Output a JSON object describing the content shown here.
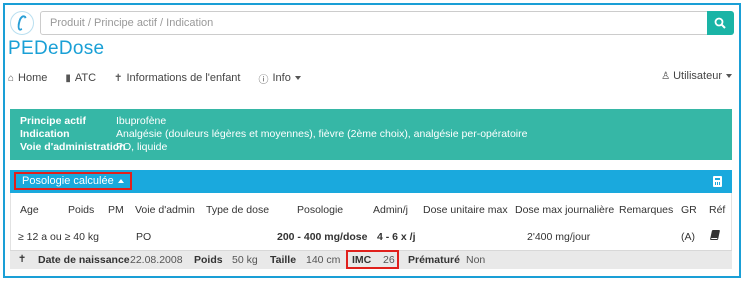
{
  "search": {
    "placeholder": "Produit / Principe actif / Indication"
  },
  "brand": "PEDeDose",
  "nav": {
    "items": [
      {
        "icon": "home-icon",
        "label": "Home"
      },
      {
        "icon": "book-icon",
        "label": "ATC"
      },
      {
        "icon": "child-icon",
        "label": "Informations de l'enfant"
      },
      {
        "icon": "info-icon",
        "label": "Info"
      }
    ],
    "user_label": "Utilisateur"
  },
  "info": {
    "principe_label": "Principe actif",
    "principe_value": "Ibuprofène",
    "indication_label": "Indication",
    "indication_value": "Analgésie (douleurs légères et moyennes), fièvre (2ème choix), analgésie per-opératoire",
    "voie_label": "Voie d'administration",
    "voie_value": "PO, liquide"
  },
  "posology": {
    "toggle_label": "Posologie calculée",
    "headers": [
      "Age",
      "Poids",
      "PM",
      "Voie d'admin",
      "Type de dose",
      "Posologie",
      "Admin/j",
      "Dose unitaire max",
      "Dose max journalière",
      "Remarques",
      "GR",
      "Réf"
    ],
    "row": {
      "age": "≥ 12 a ou ≥ 40 kg",
      "voie": "PO",
      "posologie": "200 - 400 mg/dose",
      "admin": "4 - 6 x /j",
      "dose_max_jour": "2'400 mg/jour",
      "gr": "(A)"
    }
  },
  "footer": {
    "dob_label": "Date de naissance",
    "dob_value": "22.08.2008",
    "poids_label": "Poids",
    "poids_value": "50 kg",
    "taille_label": "Taille",
    "taille_value": "140 cm",
    "imc_label": "IMC",
    "imc_value": "26",
    "premature_label": "Prématuré",
    "premature_value": "Non"
  },
  "colors": {
    "brand_blue": "#1aa0d6",
    "teal": "#36b7a6",
    "panel_blue": "#1aa9dd",
    "highlight_red": "#e0201c"
  }
}
